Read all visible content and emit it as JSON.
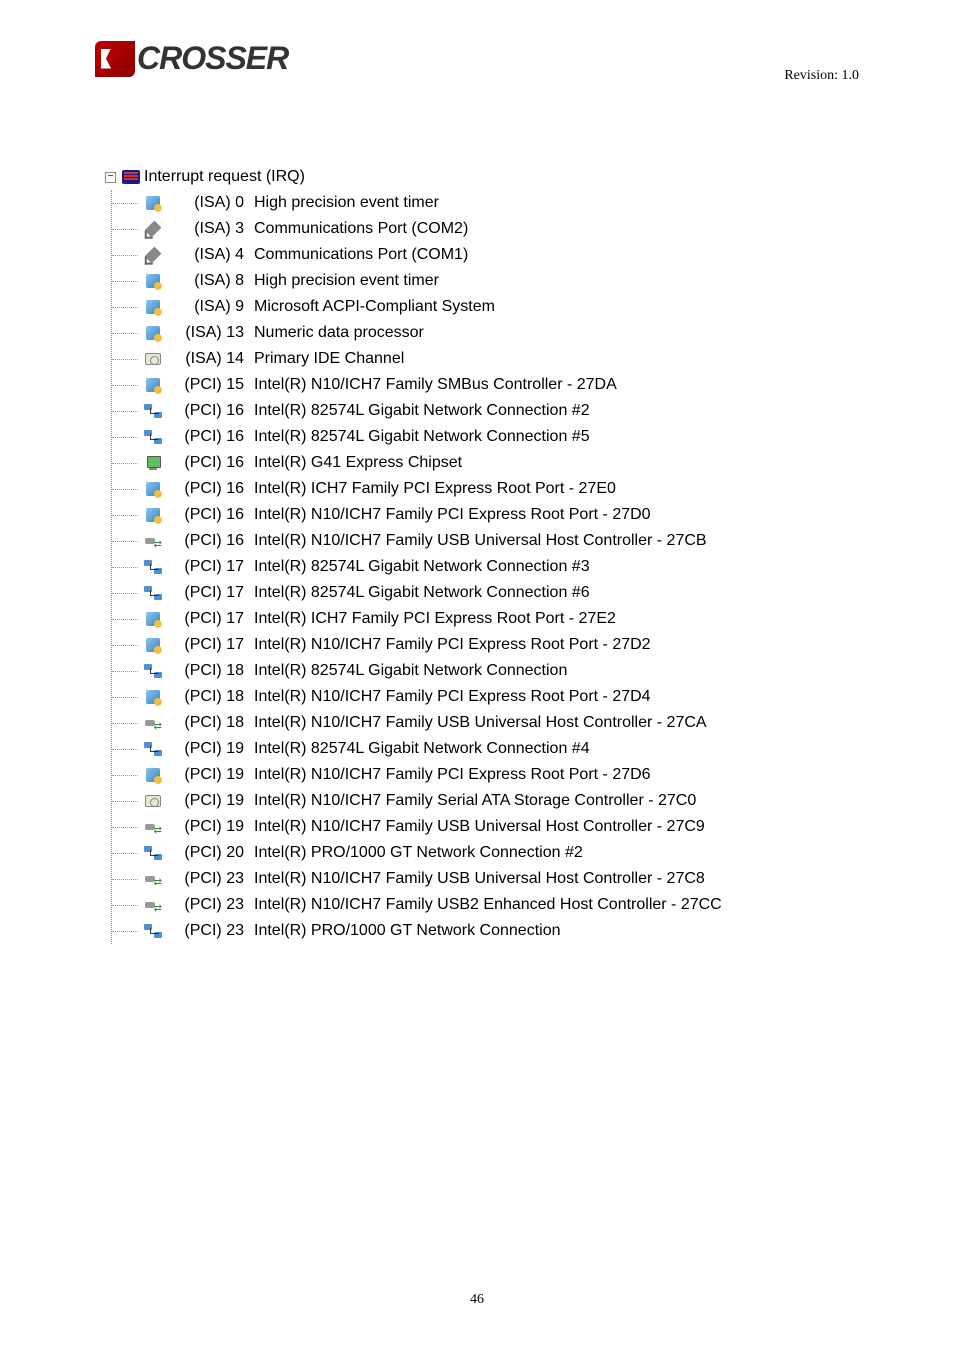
{
  "header": {
    "brand_text": "CROSSER",
    "revision": "Revision: 1.0"
  },
  "root": {
    "label": "Interrupt request (IRQ)"
  },
  "items": [
    {
      "icon": "chip",
      "irq": "(ISA) 0",
      "desc": "High precision event timer"
    },
    {
      "icon": "port",
      "irq": "(ISA) 3",
      "desc": "Communications Port (COM2)"
    },
    {
      "icon": "port",
      "irq": "(ISA) 4",
      "desc": "Communications Port (COM1)"
    },
    {
      "icon": "chip",
      "irq": "(ISA) 8",
      "desc": "High precision event timer"
    },
    {
      "icon": "chip",
      "irq": "(ISA) 9",
      "desc": "Microsoft ACPI-Compliant System"
    },
    {
      "icon": "chip",
      "irq": "(ISA) 13",
      "desc": "Numeric data processor"
    },
    {
      "icon": "disk",
      "irq": "(ISA) 14",
      "desc": "Primary IDE Channel"
    },
    {
      "icon": "chip",
      "irq": "(PCI) 15",
      "desc": "Intel(R) N10/ICH7 Family SMBus Controller - 27DA"
    },
    {
      "icon": "network",
      "irq": "(PCI) 16",
      "desc": "Intel(R) 82574L Gigabit Network Connection #2"
    },
    {
      "icon": "network",
      "irq": "(PCI) 16",
      "desc": "Intel(R) 82574L Gigabit Network Connection #5"
    },
    {
      "icon": "display",
      "irq": "(PCI) 16",
      "desc": "Intel(R) G41 Express Chipset"
    },
    {
      "icon": "chip",
      "irq": "(PCI) 16",
      "desc": "Intel(R) ICH7 Family PCI Express Root Port - 27E0"
    },
    {
      "icon": "chip",
      "irq": "(PCI) 16",
      "desc": "Intel(R) N10/ICH7 Family PCI Express Root Port - 27D0"
    },
    {
      "icon": "usb",
      "irq": "(PCI) 16",
      "desc": "Intel(R) N10/ICH7 Family USB Universal Host Controller - 27CB"
    },
    {
      "icon": "network",
      "irq": "(PCI) 17",
      "desc": "Intel(R) 82574L Gigabit Network Connection #3"
    },
    {
      "icon": "network",
      "irq": "(PCI) 17",
      "desc": "Intel(R) 82574L Gigabit Network Connection #6"
    },
    {
      "icon": "chip",
      "irq": "(PCI) 17",
      "desc": "Intel(R) ICH7 Family PCI Express Root Port - 27E2"
    },
    {
      "icon": "chip",
      "irq": "(PCI) 17",
      "desc": "Intel(R) N10/ICH7 Family PCI Express Root Port - 27D2"
    },
    {
      "icon": "network",
      "irq": "(PCI) 18",
      "desc": "Intel(R) 82574L Gigabit Network Connection"
    },
    {
      "icon": "chip",
      "irq": "(PCI) 18",
      "desc": "Intel(R) N10/ICH7 Family PCI Express Root Port - 27D4"
    },
    {
      "icon": "usb",
      "irq": "(PCI) 18",
      "desc": "Intel(R) N10/ICH7 Family USB Universal Host Controller - 27CA"
    },
    {
      "icon": "network",
      "irq": "(PCI) 19",
      "desc": "Intel(R) 82574L Gigabit Network Connection #4"
    },
    {
      "icon": "chip",
      "irq": "(PCI) 19",
      "desc": "Intel(R) N10/ICH7 Family PCI Express Root Port - 27D6"
    },
    {
      "icon": "disk",
      "irq": "(PCI) 19",
      "desc": "Intel(R) N10/ICH7 Family Serial ATA Storage Controller - 27C0"
    },
    {
      "icon": "usb",
      "irq": "(PCI) 19",
      "desc": "Intel(R) N10/ICH7 Family USB Universal Host Controller - 27C9"
    },
    {
      "icon": "network",
      "irq": "(PCI) 20",
      "desc": "Intel(R) PRO/1000 GT Network Connection #2"
    },
    {
      "icon": "usb",
      "irq": "(PCI) 23",
      "desc": "Intel(R) N10/ICH7 Family USB Universal Host Controller - 27C8"
    },
    {
      "icon": "usb",
      "irq": "(PCI) 23",
      "desc": "Intel(R) N10/ICH7 Family USB2 Enhanced Host Controller - 27CC"
    },
    {
      "icon": "network",
      "irq": "(PCI) 23",
      "desc": "Intel(R) PRO/1000 GT Network Connection"
    }
  ],
  "page_number": "46"
}
